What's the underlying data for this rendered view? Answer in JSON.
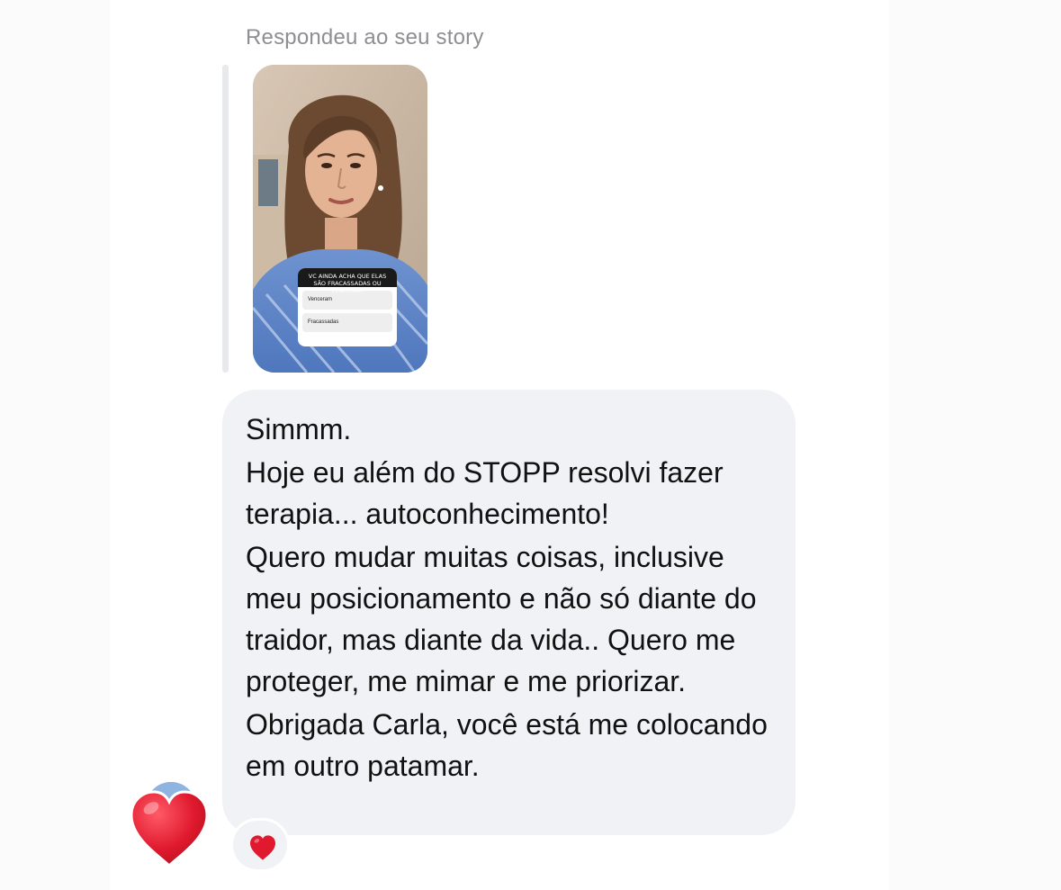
{
  "reply_label": "Respondeu ao seu story",
  "story": {
    "poll_question": "VC AINDA ACHA QUE ELAS SÃO FRACASSADAS OU VENCERAM",
    "poll_options": [
      "Venceram",
      "Fracassadas"
    ]
  },
  "message": {
    "paragraphs": [
      "Simmm.",
      "Hoje eu além do STOPP resolvi fazer terapia... autoconhecimento!",
      "Quero mudar muitas coisas, inclusive meu posicionamento e não só diante do traidor, mas diante da vida.. Quero me proteger, me mimar e me priorizar.",
      "Obrigada Carla, você está me colocando em outro patamar."
    ]
  },
  "reactions": {
    "big_heart": "heart-icon",
    "pill_heart": "heart-icon",
    "heart_color": "#e0192e"
  },
  "colors": {
    "bubble_bg": "#f1f2f5",
    "label_gray": "#8e8e93"
  }
}
